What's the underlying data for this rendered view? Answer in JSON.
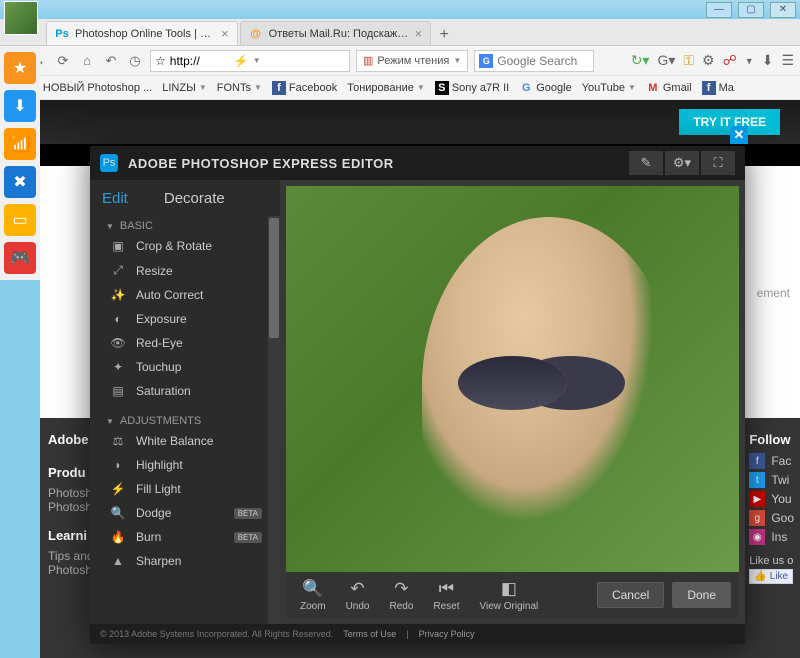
{
  "window": {
    "min": "—",
    "max": "▢",
    "close": "✕"
  },
  "tabs": [
    {
      "favicon": "Ps",
      "faviconColor": "#0099e5",
      "label": "Photoshop Online Tools | Phot..."
    },
    {
      "favicon": "@",
      "faviconColor": "#f7931e",
      "label": "Ответы Mail.Ru: Подскажите он..."
    }
  ],
  "url": {
    "scheme": "http://",
    "star": "☆",
    "bolt": "⚡"
  },
  "readmode": "Режим чтения",
  "search_placeholder": "Google Search",
  "bookmarks": [
    {
      "icon": "Ps",
      "iconColor": "#0099e5",
      "label": "НОВЫЙ Photoshop ...",
      "drop": false
    },
    {
      "icon": "",
      "label": "LINZЫ",
      "drop": true
    },
    {
      "icon": "",
      "label": "FONTs",
      "drop": true
    },
    {
      "icon": "f",
      "iconColor": "#3b5998",
      "label": "Facebook",
      "drop": false
    },
    {
      "icon": "",
      "label": "Тонирование",
      "drop": true
    },
    {
      "icon": "S",
      "iconColor": "#000",
      "label": "Sony a7R II",
      "drop": false
    },
    {
      "icon": "G",
      "iconColor": "#4285f4",
      "label": "Google",
      "drop": false
    },
    {
      "icon": "",
      "label": "YouTube",
      "drop": true
    },
    {
      "icon": "M",
      "iconColor": "#d93025",
      "label": "Gmail",
      "drop": false
    },
    {
      "icon": "f",
      "iconColor": "#3b5998",
      "label": "Ma",
      "drop": false
    }
  ],
  "launcher": [
    {
      "bg": "#f7931e",
      "glyph": "★"
    },
    {
      "bg": "#2196f3",
      "glyph": "⬇"
    },
    {
      "bg": "#ff9800",
      "glyph": "📶"
    },
    {
      "bg": "#1976d2",
      "glyph": "✖"
    },
    {
      "bg": "#ffb300",
      "glyph": "▭"
    },
    {
      "bg": "#e53935",
      "glyph": "🎮"
    }
  ],
  "page": {
    "try_free": "TRY IT FREE",
    "adobe": "Adobe",
    "products": "Produ",
    "p1": "Photosh",
    "p2": "Photosh",
    "learn": "Learni",
    "tips": "Tips and",
    "p3": "Photosh",
    "ement": "ement",
    "follow": "Follow",
    "socials": [
      {
        "bg": "#3b5998",
        "g": "f",
        "label": "Fac"
      },
      {
        "bg": "#1da1f2",
        "g": "t",
        "label": "Twi"
      },
      {
        "bg": "#cc0000",
        "g": "▶",
        "label": "You"
      },
      {
        "bg": "#dd4b39",
        "g": "g",
        "label": "Goo"
      },
      {
        "bg": "#c13584",
        "g": "◉",
        "label": "Ins"
      }
    ],
    "likeus": "Like us o",
    "like_btn": "Like"
  },
  "editor": {
    "title": "ADOBE PHOTOSHOP EXPRESS EDITOR",
    "tabs": {
      "edit": "Edit",
      "decorate": "Decorate"
    },
    "sections": {
      "basic": "BASIC",
      "adjustments": "ADJUSTMENTS"
    },
    "basic_items": [
      {
        "icon": "▣",
        "label": "Crop & Rotate"
      },
      {
        "icon": "⤢",
        "label": "Resize"
      },
      {
        "icon": "✨",
        "label": "Auto Correct"
      },
      {
        "icon": "◐",
        "label": "Exposure"
      },
      {
        "icon": "👁",
        "label": "Red-Eye"
      },
      {
        "icon": "✦",
        "label": "Touchup"
      },
      {
        "icon": "▤",
        "label": "Saturation"
      }
    ],
    "adj_items": [
      {
        "icon": "⚖",
        "label": "White Balance",
        "beta": false
      },
      {
        "icon": "◗",
        "label": "Highlight",
        "beta": false
      },
      {
        "icon": "⚡",
        "label": "Fill Light",
        "beta": false
      },
      {
        "icon": "🔍",
        "label": "Dodge",
        "beta": true
      },
      {
        "icon": "🔥",
        "label": "Burn",
        "beta": true
      },
      {
        "icon": "▲",
        "label": "Sharpen",
        "beta": false
      }
    ],
    "beta_label": "BETA",
    "tools": [
      {
        "icon": "🔍",
        "label": "Zoom"
      },
      {
        "icon": "↶",
        "label": "Undo"
      },
      {
        "icon": "↷",
        "label": "Redo"
      },
      {
        "icon": "⏮",
        "label": "Reset"
      },
      {
        "icon": "◧",
        "label": "View Original"
      }
    ],
    "cancel": "Cancel",
    "done": "Done",
    "copyright": "© 2013 Adobe Systems Incorporated. All Rights Reserved.",
    "terms": "Terms of Use",
    "sep": "|",
    "privacy": "Privacy Policy"
  }
}
